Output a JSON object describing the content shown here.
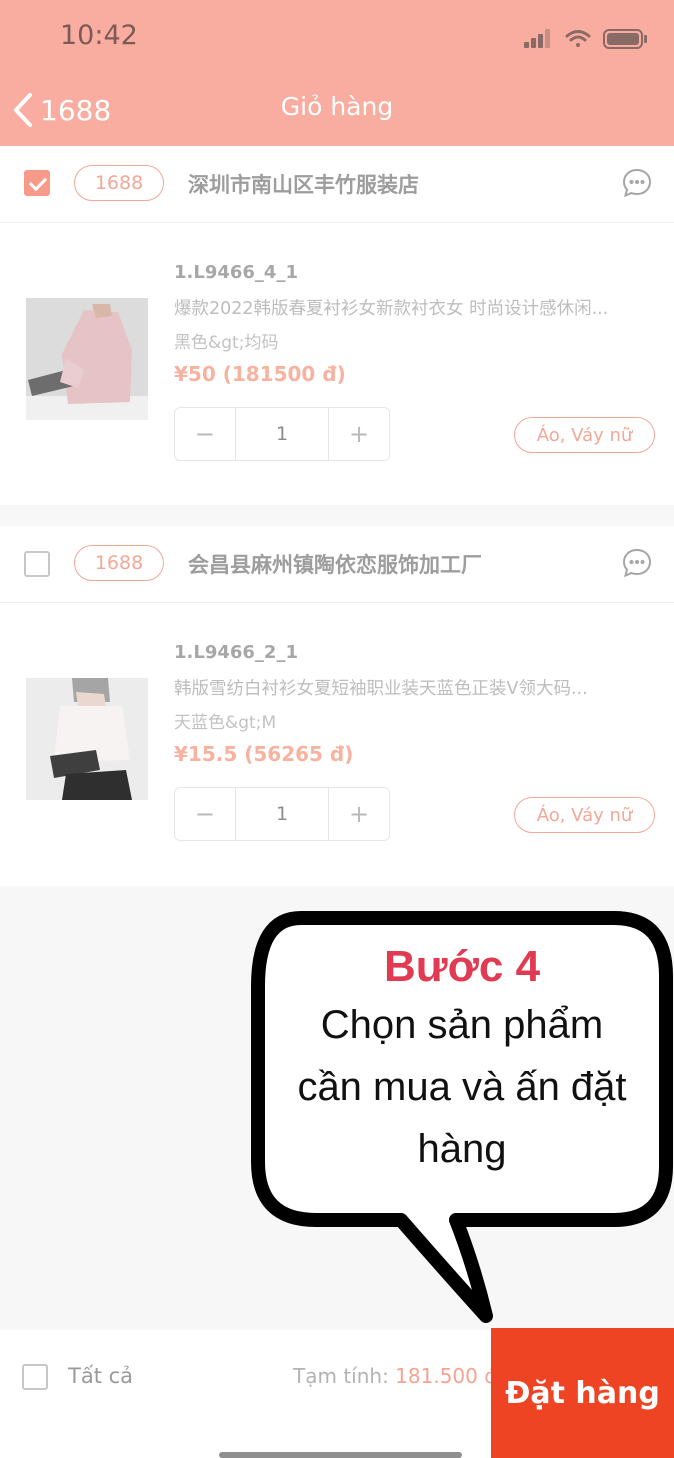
{
  "status_bar": {
    "time": "10:42"
  },
  "header": {
    "back_label": "1688",
    "title": "Giỏ hàng"
  },
  "shops": [
    {
      "checked": true,
      "platform": "1688",
      "name": "深圳市南山区丰竹服装店",
      "product": {
        "sku": "1.L9466_4_1",
        "name": "爆款2022韩版春夏衬衫女新款衬衣女 时尚设计感休闲...",
        "variant": "黑色&gt;均码",
        "price": "¥50 (181500 đ)",
        "quantity": "1",
        "category": "Áo, Váy nữ"
      }
    },
    {
      "checked": false,
      "platform": "1688",
      "name": "会昌县麻州镇陶依恋服饰加工厂",
      "product": {
        "sku": "1.L9466_2_1",
        "name": "韩版雪纺白衬衫女夏短袖职业装天蓝色正装V领大码...",
        "variant": "天蓝色&gt;M",
        "price": "¥15.5 (56265 đ)",
        "quantity": "1",
        "category": "Áo, Váy nữ"
      }
    }
  ],
  "callout": {
    "title": "Bước 4",
    "lines": [
      "Chọn sản phẩm",
      "cần mua và ấn đặt",
      "hàng"
    ]
  },
  "footer": {
    "select_all_label": "Tất cả",
    "subtotal_label": "Tạm tính:",
    "subtotal_value": "181.500 đ",
    "order_button": "Đặt hàng"
  },
  "colors": {
    "header": "#f9ada0",
    "accent": "#f2a898",
    "order_button": "#ee4423",
    "callout_title": "#e03b52"
  }
}
